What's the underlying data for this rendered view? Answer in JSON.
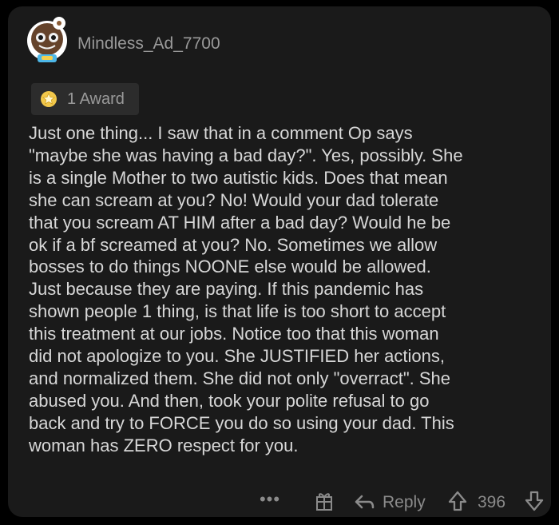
{
  "comment": {
    "author": "Mindless_Ad_7700",
    "award_label": "1 Award",
    "body": "Just one thing... I saw that in a comment Op says\n\"maybe she was having a bad day?\". Yes, possibly. She\nis a single Mother to two autistic kids. Does that mean\nshe can scream at you? No! Would your dad tolerate\nthat you scream AT HIM after a bad day? Would he be\nok if a bf screamed at you? No. Sometimes we allow\nbosses to do things NOONE else would be allowed.\nJust because they are paying. If this pandemic has\nshown people 1 thing, is that life is too short to accept\nthis treatment at  our jobs. Notice too that this woman\ndid not apologize to you. She JUSTIFIED her actions,\nand normalized them. She did not only \"overract\". She\nabused you. And then, took your polite refusal to go\nback and try to FORCE  you do so using your dad. This\nwoman has ZERO  respect for you."
  },
  "actions": {
    "more_label": "•••",
    "reply_label": "Reply",
    "score": "396"
  },
  "icons": {
    "avatar": "snoo-avatar-icon",
    "award": "award-icon",
    "gift": "gift-icon",
    "reply": "reply-arrow-icon",
    "upvote": "upvote-arrow-icon",
    "downvote": "downvote-arrow-icon"
  },
  "colors": {
    "background": "#000000",
    "card": "#1a1a1a",
    "text": "#d7d7d7",
    "muted": "#8b8b8b",
    "award": "#f2c84b"
  }
}
